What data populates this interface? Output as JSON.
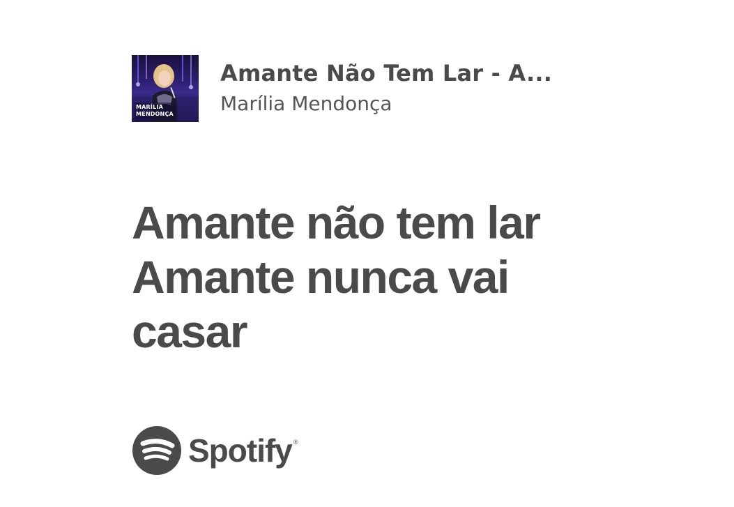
{
  "track": {
    "title": "Amante Não Tem Lar - A...",
    "artist": "Marília Mendonça",
    "album_art_text": "MARÍLIA MENDONÇA"
  },
  "lyrics": {
    "lines": [
      "Amante não tem lar",
      "Amante nunca vai",
      "casar"
    ]
  },
  "brand": {
    "name": "Spotify",
    "registered": "®",
    "icon": "spotify-logo-icon"
  },
  "colors": {
    "background": "#ffffff",
    "text_primary": "#4a4a4a",
    "text_secondary": "#555555"
  }
}
